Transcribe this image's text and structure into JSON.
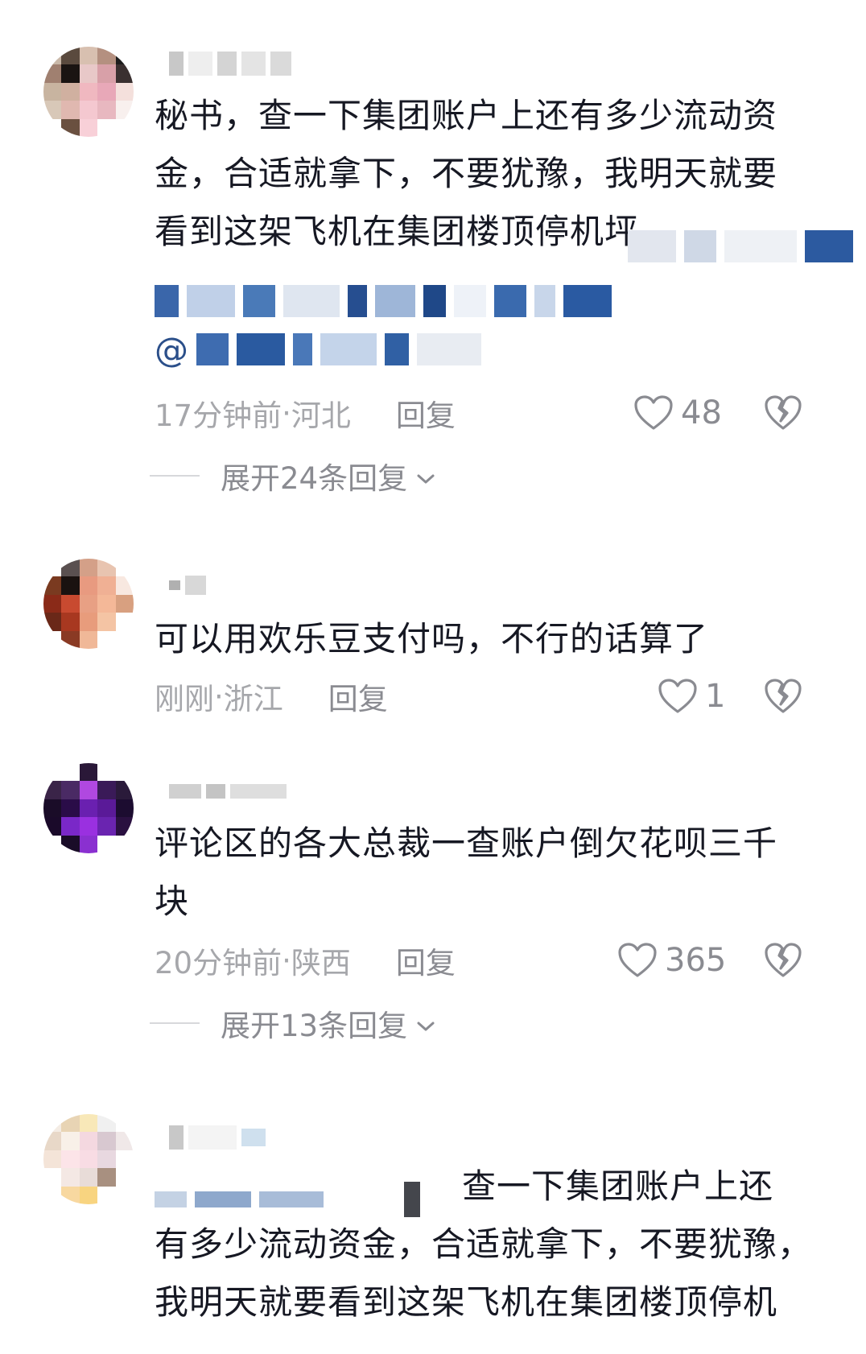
{
  "comments": [
    {
      "text_lines": [
        "秘书，查一下集团账户上还有多少流动资",
        "金，合适就拿下，不要犹豫，我明天就要",
        "看到这架飞机在集团楼顶停机坪"
      ],
      "mention_prefix": "@",
      "time": "17分钟前",
      "location": "河北",
      "reply_label": "回复",
      "likes": "48",
      "expand_label": "展开24条回复"
    },
    {
      "text_lines": [
        "可以用欢乐豆支付吗，不行的话算了"
      ],
      "time": "刚刚",
      "location": "浙江",
      "reply_label": "回复",
      "likes": "1"
    },
    {
      "text_lines": [
        "评论区的各大总裁一查账户倒欠花呗三千",
        "块"
      ],
      "time": "20分钟前",
      "location": "陕西",
      "reply_label": "回复",
      "likes": "365",
      "expand_label": "展开13条回复"
    },
    {
      "text_lines": [
        "查一下集团账户上还",
        "有多少流动资金，合适就拿下，不要犹豫，",
        "我明天就要看到这架飞机在集团楼顶停机"
      ]
    }
  ],
  "separator": " · "
}
